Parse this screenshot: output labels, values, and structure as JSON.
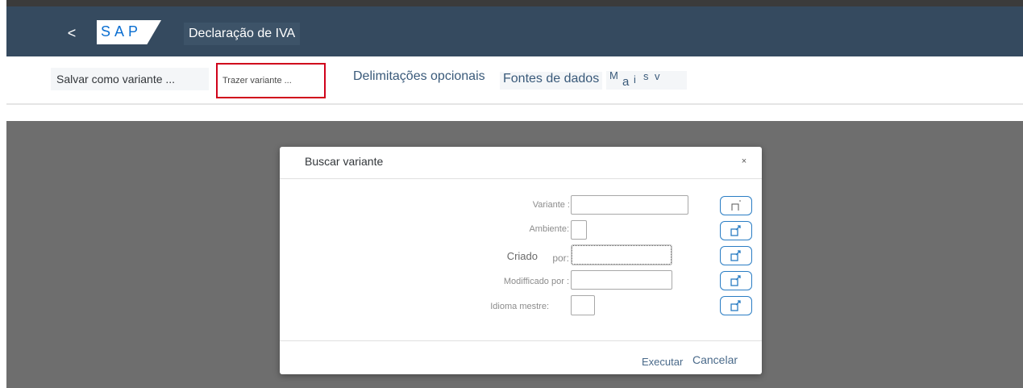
{
  "header": {
    "back_label": "<",
    "logo_text": "SAP",
    "app_title": "Declaração de IVA"
  },
  "toolbar": {
    "save_variant": "Salvar como variante ...",
    "bring_variant": "Trazer variante ...",
    "optional_delimitations": "Delimitações opcionais",
    "data_sources": "Fontes de dados",
    "more_parts": [
      "M",
      "a",
      "i",
      "s",
      "v"
    ]
  },
  "dialog": {
    "title": "Buscar variante",
    "close_label": "×",
    "fields": [
      {
        "label": "Variante :",
        "value": ""
      },
      {
        "label": "Ambiente:",
        "value": ""
      },
      {
        "label_a": "Criado",
        "label_b": "por:",
        "value": ""
      },
      {
        "label": "Modifficado por :",
        "value": ""
      },
      {
        "label": "Idioma mestre:",
        "value": ""
      }
    ],
    "execute_label": "Executar",
    "cancel_label": "Cancelar"
  },
  "colors": {
    "shellbar": "#354a5f",
    "accent": "#0a6ed1",
    "highlight_border": "#d0021b",
    "overlay": "#6e6e6e"
  }
}
